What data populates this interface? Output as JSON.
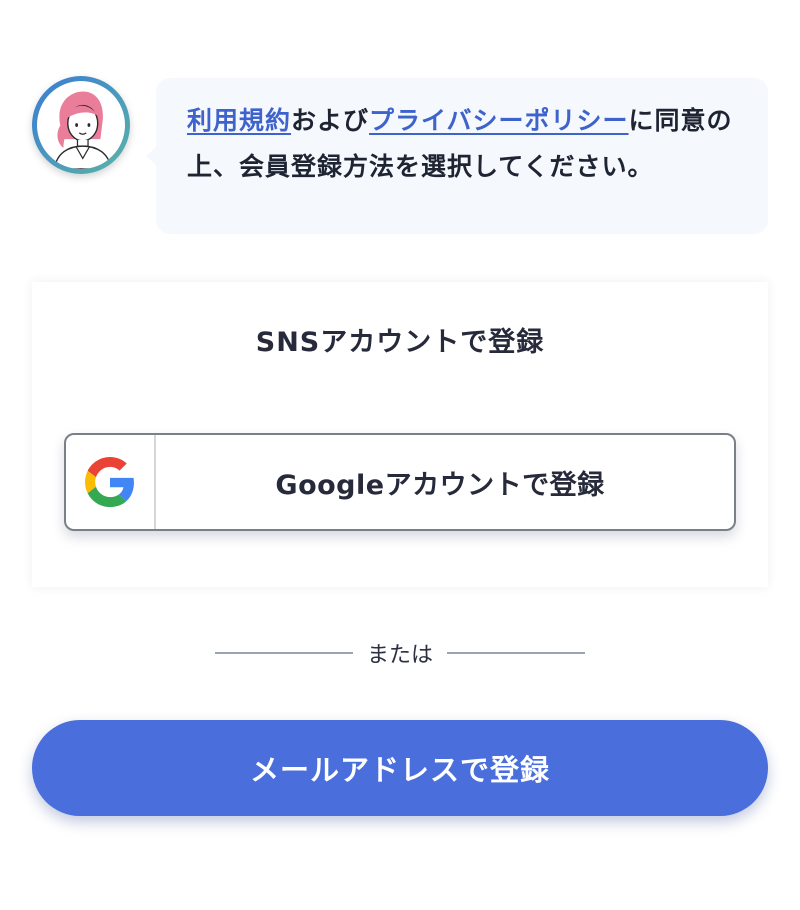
{
  "avatar": {
    "icon": "female-support-avatar-icon"
  },
  "bubble": {
    "terms_link": "利用規約",
    "and_text": "および",
    "privacy_link": "プライバシーポリシー",
    "message": "に同意の上、会員登録方法を選択してください。"
  },
  "sns": {
    "title": "SNSアカウントで登録",
    "google_button_label": "Googleアカウントで登録",
    "google_icon": "google-logo-icon"
  },
  "divider": {
    "label": "または"
  },
  "email_button": {
    "label": "メールアドレスで登録"
  },
  "colors": {
    "accent": "#4a6fdd",
    "link": "#3f63cc",
    "bubble_bg": "#f5f8fd",
    "text": "#1f2433"
  }
}
